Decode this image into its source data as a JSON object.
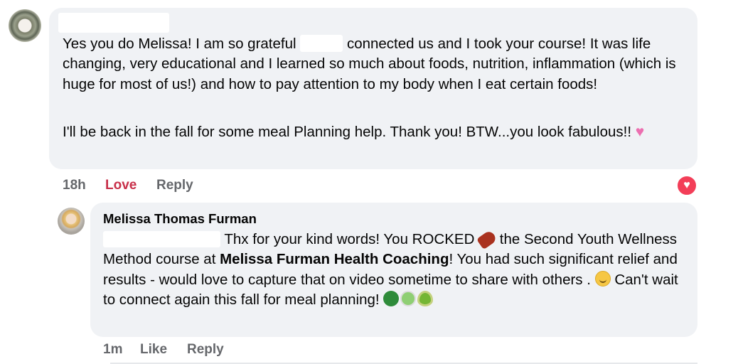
{
  "comment1": {
    "paragraph1_a": "Yes you do Melissa! I am so grateful ",
    "paragraph1_b": " connected us and I took your course! It was life changing, very educational and I learned so much about foods, nutrition, inflammation (which is huge for most of us!) and how to pay attention to my body when I eat certain foods!",
    "paragraph2": "I'll be back in the fall for some meal Planning help. Thank you! BTW...you look fabulous!!",
    "time": "18h",
    "love": "Love",
    "reply": "Reply",
    "reaction": "love-reaction-icon",
    "emoji": "pink-heart-emoji"
  },
  "comment2": {
    "author": "Melissa Thomas Furman",
    "text_a": " Thx for your kind words! You ROCKED ",
    "text_b": " the Second Youth Wellness Method course at ",
    "bold": "Melissa Furman Health Coaching",
    "text_c": "! You had such significant relief and results - would love to capture that on video sometime to share with others . ",
    "text_d": " Can't wait to connect again this fall for meal planning! ",
    "time": "1m",
    "like": "Like",
    "reply": "Reply"
  }
}
